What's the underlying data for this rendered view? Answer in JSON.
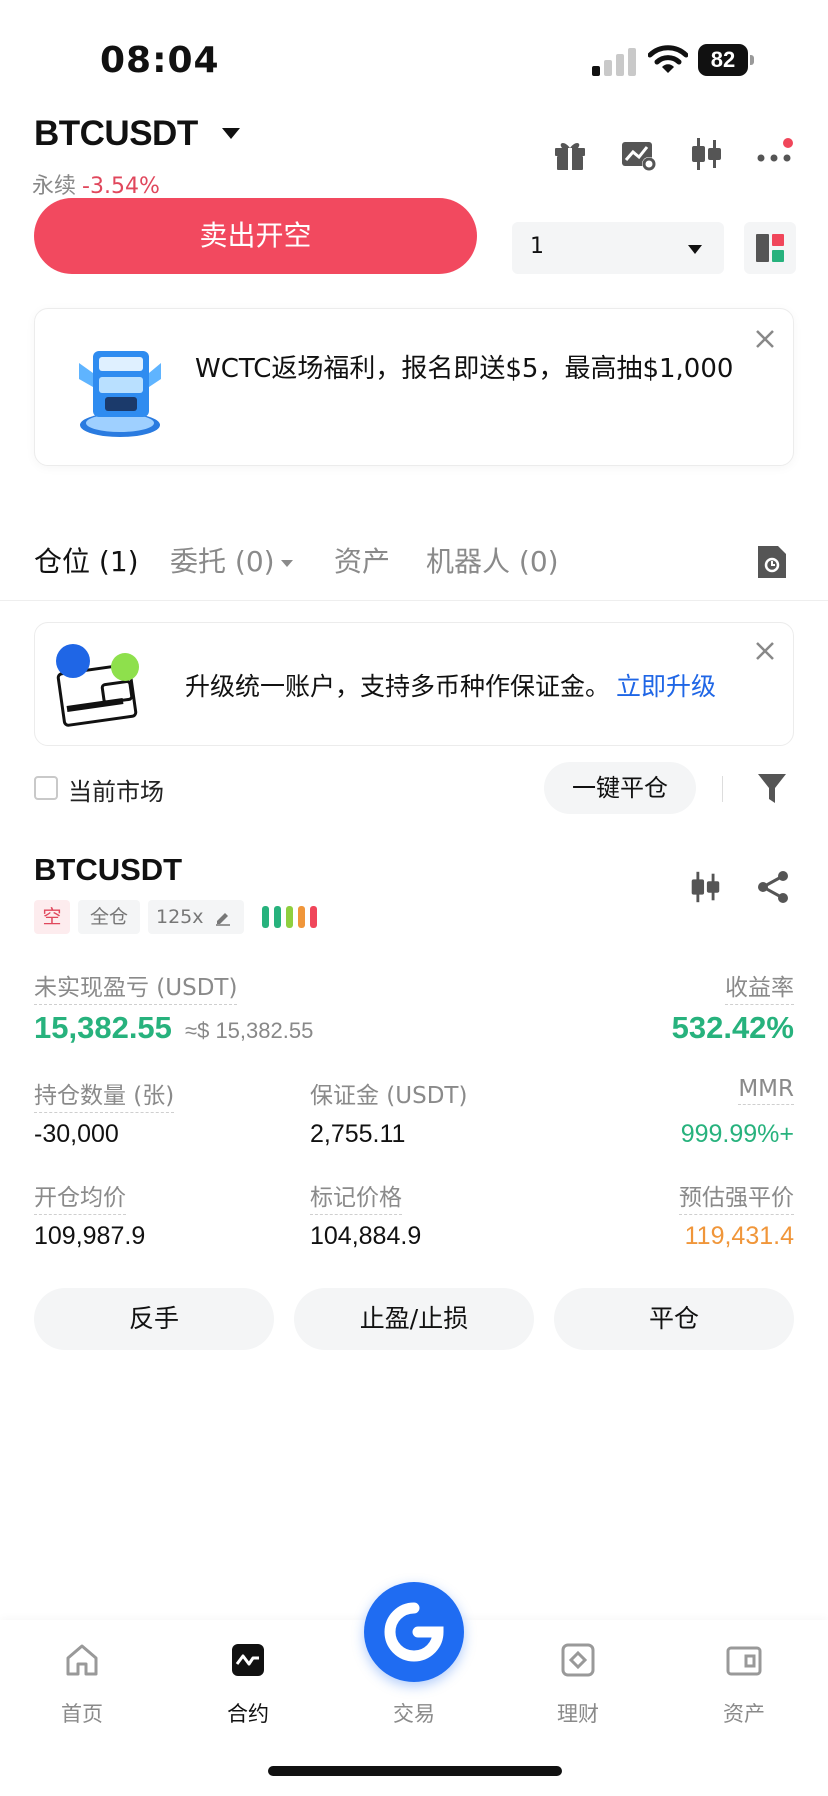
{
  "status_bar": {
    "time": "08:04",
    "battery": "82"
  },
  "header": {
    "pair": "BTCUSDT",
    "contract_type": "永续",
    "change": "-3.54%"
  },
  "trade": {
    "sell_label": "卖出开空",
    "qty_value": "1"
  },
  "promo": {
    "text": "WCTC返场福利，报名即送$5，最高抽$1,000"
  },
  "tabs": [
    {
      "label": "仓位 (1)"
    },
    {
      "label": "委托 (0)"
    },
    {
      "label": "资产"
    },
    {
      "label": "机器人 (0)"
    }
  ],
  "upgrade": {
    "text": "升级统一账户，支持多币种作保证金。",
    "link": "立即升级"
  },
  "filter": {
    "current_market": "当前市场",
    "close_all": "一键平仓"
  },
  "position": {
    "symbol": "BTCUSDT",
    "tags": {
      "side": "空",
      "margin_mode": "全仓",
      "leverage": "125x"
    },
    "unrealized_pnl_label": "未实现盈亏 (USDT)",
    "unrealized_pnl": "15,382.55",
    "unrealized_pnl_usd": "≈$ 15,382.55",
    "roe_label": "收益率",
    "roe": "532.42%",
    "size_label": "持仓数量 (张)",
    "size": "-30,000",
    "margin_label": "保证金 (USDT)",
    "margin": "2,755.11",
    "mmr_label": "MMR",
    "mmr": "999.99%+",
    "entry_label": "开仓均价",
    "entry": "109,987.9",
    "mark_label": "标记价格",
    "mark": "104,884.9",
    "liq_label": "预估强平价",
    "liq": "119,431.4",
    "actions": {
      "reverse": "反手",
      "tpsl": "止盈/止损",
      "close": "平仓"
    }
  },
  "bottom_nav": [
    {
      "label": "首页",
      "icon": "home-icon"
    },
    {
      "label": "合约",
      "icon": "futures-icon"
    },
    {
      "label": "交易",
      "icon": "trade-icon"
    },
    {
      "label": "理财",
      "icon": "earn-icon"
    },
    {
      "label": "资产",
      "icon": "wallet-icon"
    }
  ],
  "colors": {
    "sell": "#f2495f",
    "profit": "#27b27d",
    "loss": "#e0475c",
    "liquidation": "#f0963a",
    "link": "#1f66e6",
    "brand": "#1f6cf2"
  }
}
